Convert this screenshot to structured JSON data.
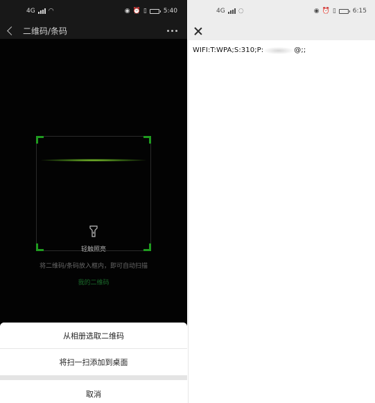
{
  "left": {
    "status": {
      "time": "5:40",
      "network": "4G"
    },
    "nav": {
      "title": "二维码/条码"
    },
    "torch_label": "轻触照亮",
    "hint": "将二维码/条码放入框内，即可自动扫描",
    "my_qr": "我的二维码",
    "sheet": {
      "option1": "从相册选取二维码",
      "option2": "将扫一扫添加到桌面",
      "cancel": "取消"
    },
    "colors": {
      "accent": "#1f9a1f",
      "background": "#030303"
    }
  },
  "right": {
    "status": {
      "time": "6:15",
      "network": "4G"
    },
    "result_prefix": "WIFI:T:WPA;S:310;P:",
    "result_suffix": "@;;"
  }
}
